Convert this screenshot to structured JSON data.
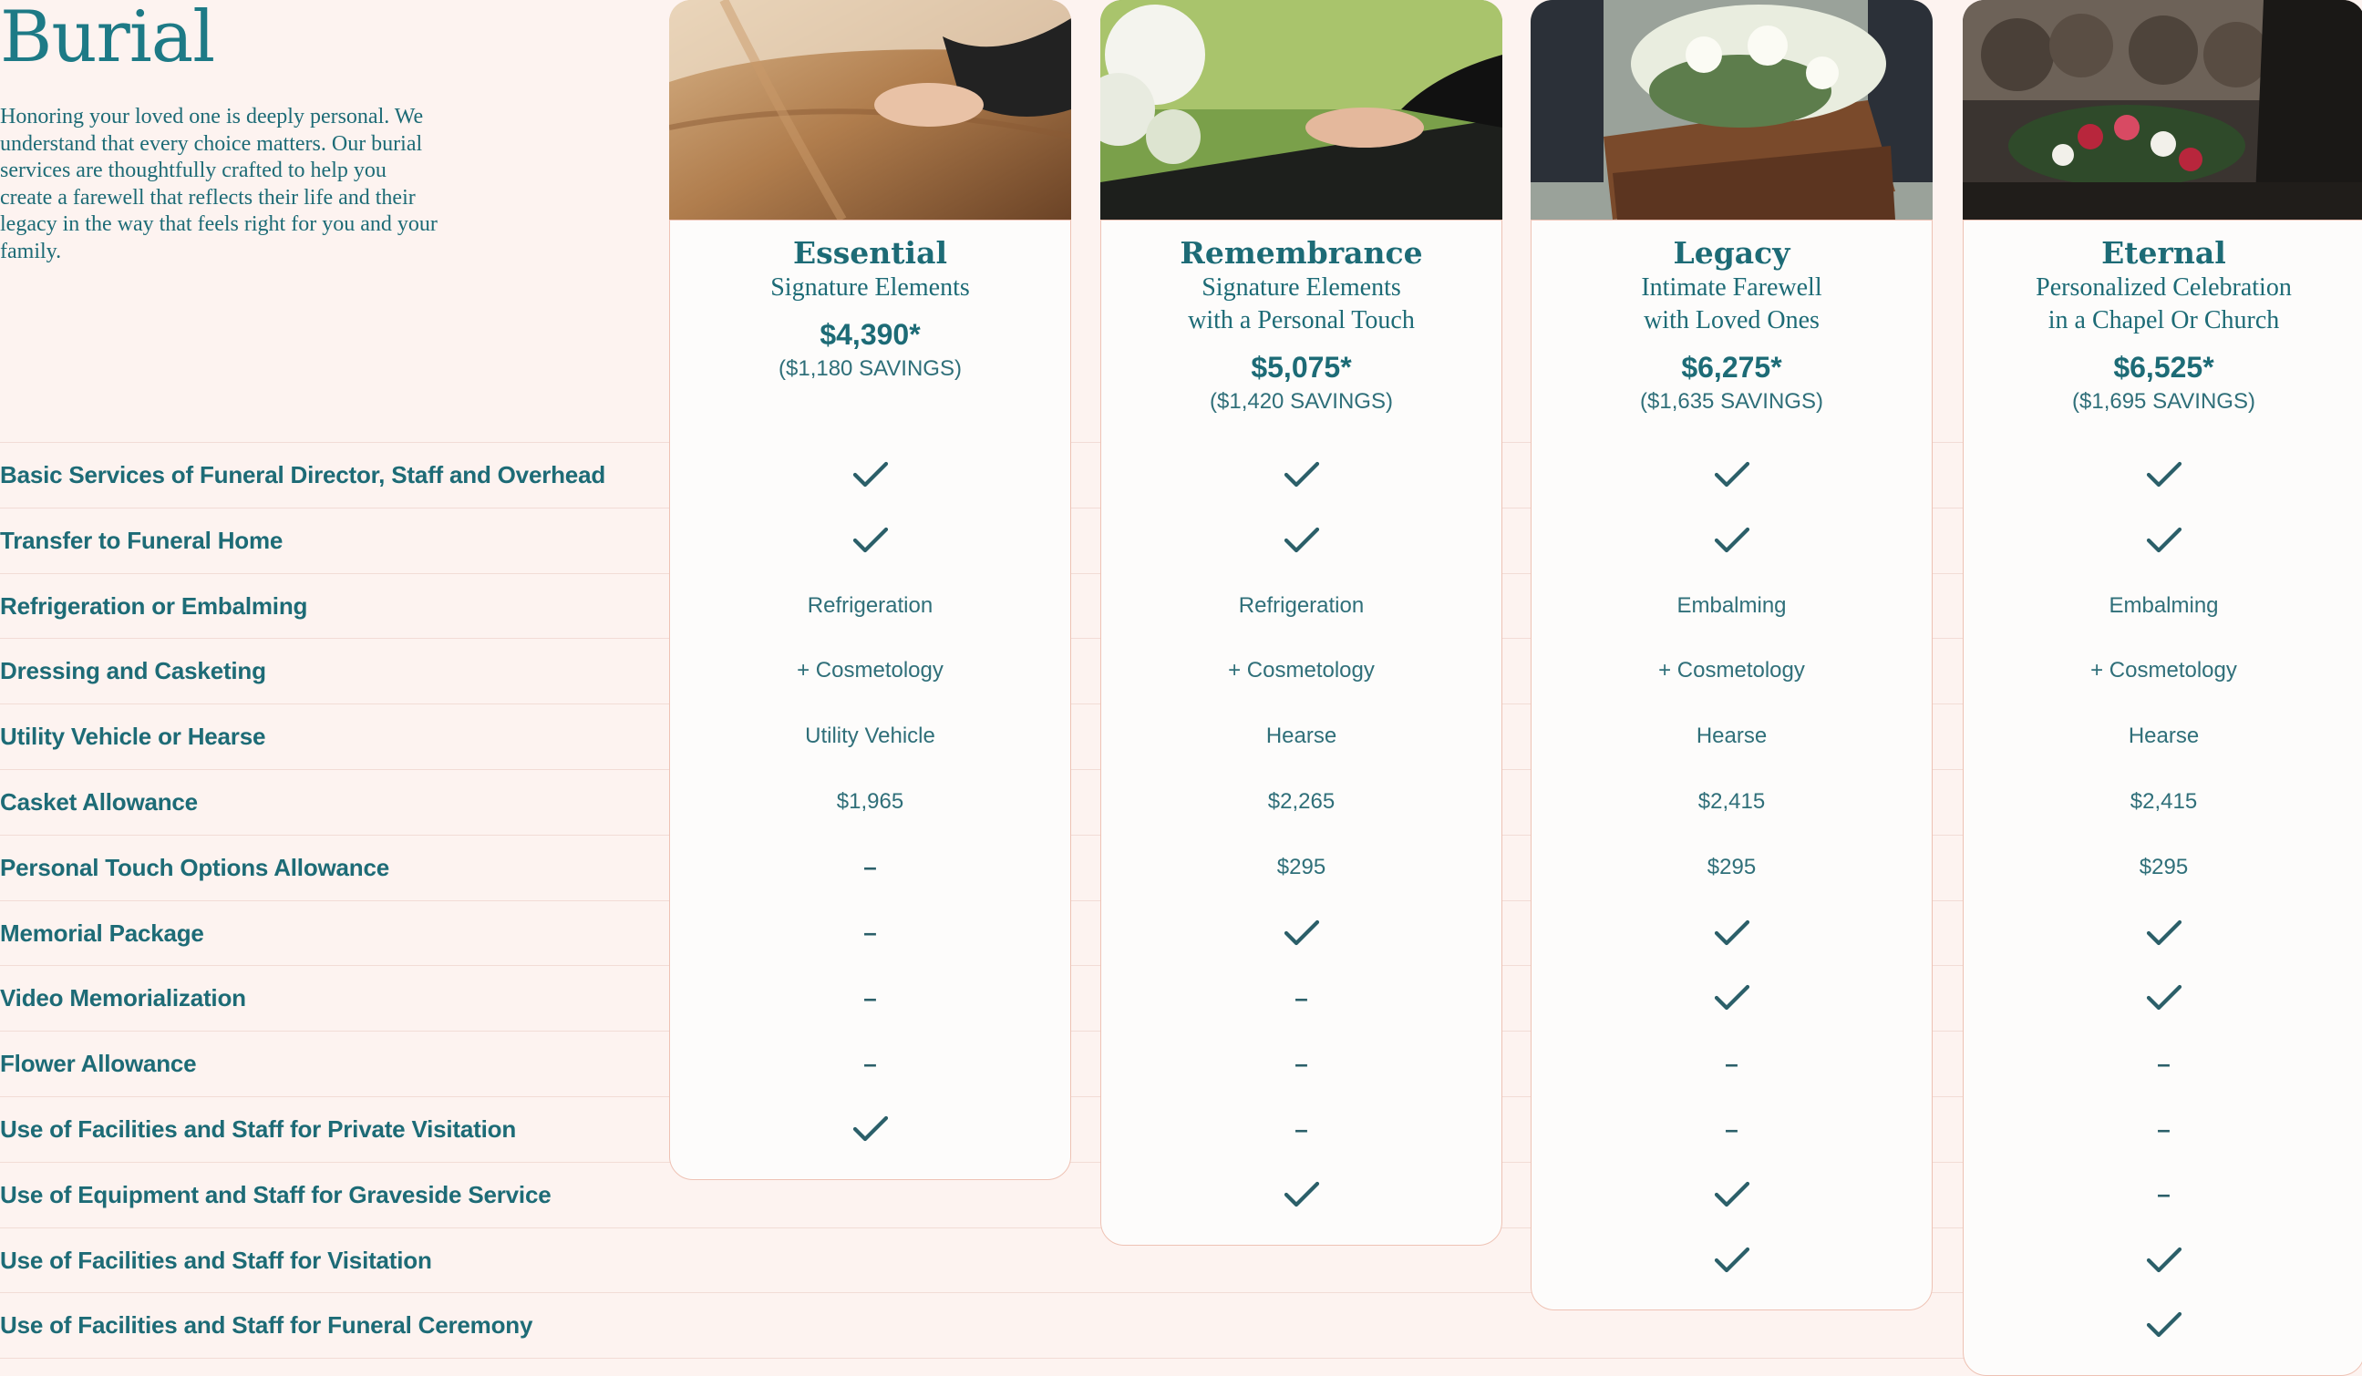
{
  "page": {
    "title": "Burial",
    "intro": "Honoring your loved one is deeply personal. We understand that every choice matters. Our burial services are thoughtfully crafted to help you create a farewell that reflects their life and their legacy in the way that feels right for you and your family."
  },
  "colors": {
    "background": "#fdf3f0",
    "teal": "#1d6b76",
    "card_border": "#eec2b4"
  },
  "features": [
    "Basic Services of Funeral Director, Staff and Overhead",
    "Transfer to Funeral Home",
    "Refrigeration or Embalming",
    "Dressing and Casketing",
    "Utility Vehicle or Hearse",
    "Casket Allowance",
    "Personal Touch Options Allowance",
    "Memorial Package",
    "Video Memorialization",
    "Flower Allowance",
    "Use of Facilities and Staff for Private Visitation",
    "Use of Equipment and Staff for Graveside Service",
    "Use of Facilities and Staff for Visitation",
    "Use of Facilities and Staff for Funeral Ceremony"
  ],
  "plans": [
    {
      "name": "Essential",
      "subtitle": "Signature Elements",
      "price": "$4,390*",
      "savings": "($1,180 SAVINGS)",
      "photo": "hand-on-casket-photo",
      "values": [
        "check",
        "check",
        "Refrigeration",
        "+ Cosmetology",
        "Utility Vehicle",
        "$1,965",
        "–",
        "–",
        "–",
        "–",
        "check"
      ]
    },
    {
      "name": "Remembrance",
      "subtitle": "Signature Elements\nwith a Personal Touch",
      "price": "$5,075*",
      "savings": "($1,420 SAVINGS)",
      "photo": "hand-on-casket-flowers-photo",
      "values": [
        "check",
        "check",
        "Refrigeration",
        "+ Cosmetology",
        "Hearse",
        "$2,265",
        "$295",
        "check",
        "–",
        "–",
        "–",
        "check"
      ]
    },
    {
      "name": "Legacy",
      "subtitle": "Intimate Farewell\nwith Loved Ones",
      "price": "$6,275*",
      "savings": "($1,635 SAVINGS)",
      "photo": "casket-with-flowers-photo",
      "values": [
        "check",
        "check",
        "Embalming",
        "+ Cosmetology",
        "Hearse",
        "$2,415",
        "$295",
        "check",
        "check",
        "–",
        "–",
        "check",
        "check"
      ]
    },
    {
      "name": "Eternal",
      "subtitle": "Personalized Celebration\nin a Chapel Or Church",
      "price": "$6,525*",
      "savings": "($1,695 SAVINGS)",
      "photo": "chapel-ceremony-photo",
      "values": [
        "check",
        "check",
        "Embalming",
        "+ Cosmetology",
        "Hearse",
        "$2,415",
        "$295",
        "check",
        "check",
        "–",
        "–",
        "–",
        "check",
        "check"
      ]
    }
  ]
}
